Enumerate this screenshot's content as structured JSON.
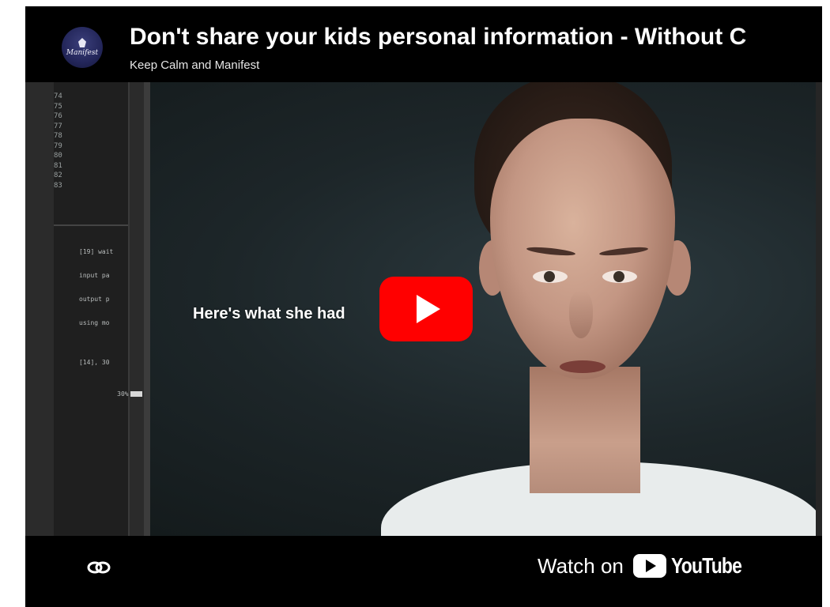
{
  "header": {
    "title": "Don't share your kids personal information - Without C",
    "channel_name": "Keep Calm and Manifest",
    "avatar_text": "Manifest",
    "avatar_icon": "channel-logo-icon"
  },
  "video": {
    "caption": "Here's what she had",
    "terminal": {
      "line_numbers": [
        "74",
        "75",
        "76",
        "77",
        "78",
        "79",
        "80",
        "81",
        "82",
        "83"
      ],
      "log_lines": [
        "[19] wait",
        "input pa",
        "output p",
        "using mo",
        "",
        "[14], 30",
        "30%"
      ]
    },
    "play_icon": "play-icon"
  },
  "bottom_bar": {
    "link_icon": "link-icon",
    "watch_on_label": "Watch on",
    "youtube_wordmark": "YouTube"
  },
  "colors": {
    "play_button": "#ff0000",
    "background": "#000000",
    "text": "#ffffff"
  }
}
